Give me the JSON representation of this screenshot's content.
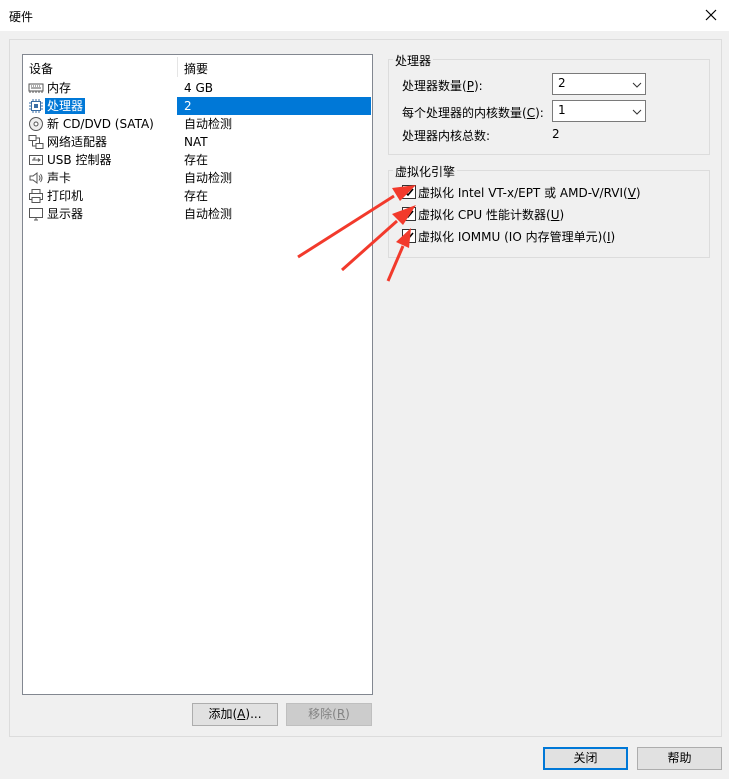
{
  "window": {
    "title": "硬件"
  },
  "device_list": {
    "header": {
      "device": "设备",
      "summary": "摘要"
    },
    "items": [
      {
        "name": "内存",
        "summary": "4 GB",
        "icon": "memory-icon"
      },
      {
        "name": "处理器",
        "summary": "2",
        "icon": "processor-icon",
        "selected": true
      },
      {
        "name": "新 CD/DVD (SATA)",
        "summary": "自动检测",
        "icon": "cd-dvd-icon"
      },
      {
        "name": "网络适配器",
        "summary": "NAT",
        "icon": "network-adapter-icon"
      },
      {
        "name": "USB 控制器",
        "summary": "存在",
        "icon": "usb-controller-icon"
      },
      {
        "name": "声卡",
        "summary": "自动检测",
        "icon": "sound-card-icon"
      },
      {
        "name": "打印机",
        "summary": "存在",
        "icon": "printer-icon"
      },
      {
        "name": "显示器",
        "summary": "自动检测",
        "icon": "display-icon"
      }
    ]
  },
  "buttons": {
    "add": {
      "pre": "添加(",
      "key": "A",
      "post": ")..."
    },
    "remove": {
      "pre": "移除(",
      "key": "R",
      "post": ")"
    },
    "close": "关闭",
    "help": "帮助"
  },
  "processor": {
    "group_title": "处理器",
    "count_label": {
      "pre": "处理器数量(",
      "key": "P",
      "post": "):"
    },
    "count_value": "2",
    "cores_label": {
      "pre": "每个处理器的内核数量(",
      "key": "C",
      "post": "):"
    },
    "cores_value": "1",
    "total_label": "处理器内核总数:",
    "total_value": "2"
  },
  "virtualization": {
    "group_title": "虚拟化引擎",
    "options": [
      {
        "pre": "虚拟化 Intel VT-x/EPT 或 AMD-V/RVI(",
        "key": "V",
        "post": ")",
        "checked": true
      },
      {
        "pre": "虚拟化 CPU 性能计数器(",
        "key": "U",
        "post": ")",
        "checked": true
      },
      {
        "pre": "虚拟化 IOMMU (IO 内存管理单元)(",
        "key": "I",
        "post": ")",
        "checked": true
      }
    ]
  },
  "annotation_color": "#f23a2c"
}
